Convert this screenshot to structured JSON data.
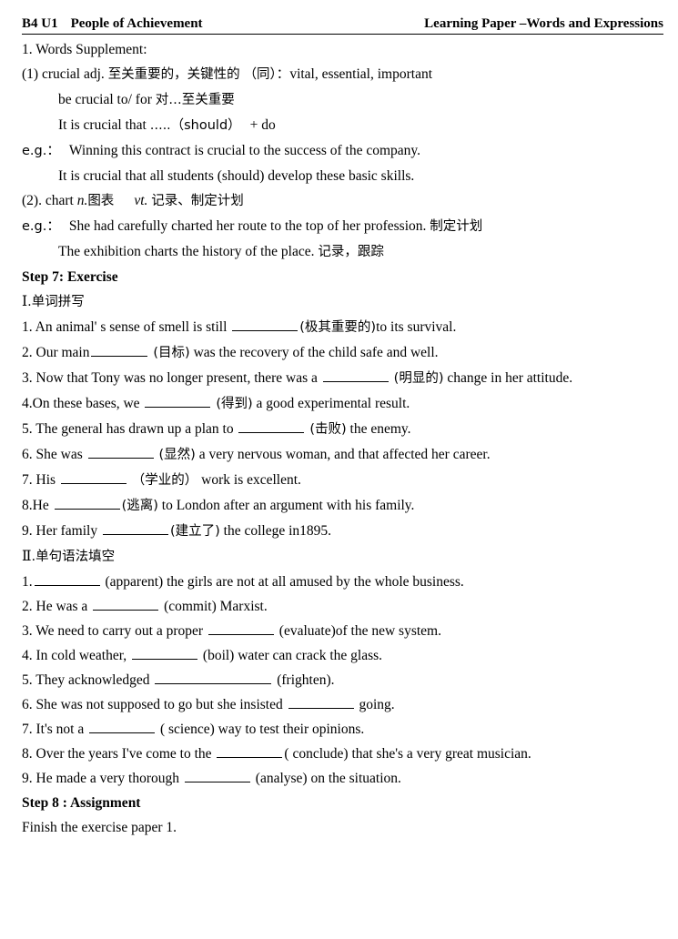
{
  "header": {
    "unit": "B4 U1",
    "title": "People of Achievement",
    "right": "Learning Paper –Words and Expressions"
  },
  "words_supplement": {
    "heading": "1. Words Supplement:",
    "entries": [
      {
        "number": "(1)",
        "word": "crucial",
        "pos": "adj.",
        "meaning_cn": "至关重要的，关键性的",
        "synonym_label": "（同）：",
        "synonyms": "vital, essential, important",
        "usages": [
          {
            "en": "be crucial to/ for",
            "cn": "对…至关重要"
          },
          {
            "en_pre": "It is crucial that",
            "dots": "…..",
            "paren": "（should）",
            "tail": "+ do"
          }
        ],
        "examples_label": "e.g.：",
        "examples": [
          {
            "text": "Winning this contract is crucial to the success of the company.",
            "note": ""
          },
          {
            "text": "It is crucial that all students (should) develop these basic skills.",
            "note": ""
          }
        ]
      },
      {
        "number": "(2).",
        "word": "chart",
        "pos1": "n.",
        "meaning1_cn": "图表",
        "pos2": "vt.",
        "meaning2_cn": "记录、制定计划",
        "examples_label": "e.g.：",
        "examples": [
          {
            "text": "She had carefully charted her route to the top of her profession.",
            "note": "制定计划"
          },
          {
            "text": "The exhibition charts the history of the place.",
            "note": "记录，跟踪"
          }
        ]
      }
    ]
  },
  "step7": {
    "heading": "Step 7: Exercise",
    "part1": {
      "numeral": "I",
      "title": ".单词拼写",
      "items": [
        {
          "num": "1.",
          "pre": "An animal' s sense of smell is still",
          "blank": "b-m",
          "hint": "(极其重要的)",
          "post": "to its survival."
        },
        {
          "num": "2.",
          "pre": "Our main",
          "blank": "b-s",
          "hint": "(目标)",
          "post": "was the recovery of the child safe and well."
        },
        {
          "num": "3.",
          "pre": "Now that Tony was no longer present, there was a",
          "blank": "b-m",
          "hint": "(明显的)",
          "post": "change in her attitude."
        },
        {
          "num": "4.",
          "pre": "On these bases, we",
          "blank": "b-m",
          "hint": "(得到)",
          "post": "a good experimental result."
        },
        {
          "num": "5.",
          "pre": "The general has drawn up a plan to",
          "blank": "b-m",
          "hint": "(击败)",
          "post": "the enemy."
        },
        {
          "num": "6.",
          "pre": "She was",
          "blank": "b-m",
          "hint": "(显然)",
          "post": "a very nervous woman, and that affected her career."
        },
        {
          "num": "7.",
          "pre": "His",
          "blank": "b-m",
          "hint": "（学业的）",
          "post": "work is excellent."
        },
        {
          "num": "8.",
          "pre": "He",
          "blank": "b-m",
          "hint": "(逃离)",
          "post": "to London after an argument with his family."
        },
        {
          "num": "9.",
          "pre": "Her family",
          "blank": "b-m",
          "hint": "(建立了)",
          "post": "the college in1895."
        }
      ]
    },
    "part2": {
      "numeral": "Ⅱ",
      "title": ".单句语法填空",
      "items": [
        {
          "num": "1.",
          "pre": "",
          "blank": "b-m",
          "hint": "(apparent)",
          "post": "the girls are not at all amused by the whole business."
        },
        {
          "num": "2.",
          "pre": "He was a",
          "blank": "b-m",
          "hint": "(commit)",
          "post": "Marxist."
        },
        {
          "num": "3.",
          "pre": "We need to carry out a proper",
          "blank": "b-m",
          "hint": "(evaluate)",
          "post": "of the new system."
        },
        {
          "num": "4.",
          "pre": "In cold weather,",
          "blank": "b-m",
          "hint": "(boil)",
          "post": "water can crack the glass."
        },
        {
          "num": "5.",
          "pre": "They acknowledged",
          "blank": "b-l",
          "hint": "(frighten).",
          "post": ""
        },
        {
          "num": "6.",
          "pre": "She was not supposed to go but she insisted",
          "blank": "b-m",
          "hint": "",
          "post": "going."
        },
        {
          "num": "7.",
          "pre": "It's not a",
          "blank": "b-m",
          "hint": "( science)",
          "post": "way to test their opinions."
        },
        {
          "num": "8.",
          "pre": "Over the years I've come to the",
          "blank": "b-m",
          "hint": "( conclude)",
          "post": "that she's a very great musician."
        },
        {
          "num": "9.",
          "pre": "He made a very thorough",
          "blank": "b-m",
          "hint": "(analyse)",
          "post": "on the situation."
        }
      ]
    }
  },
  "step8": {
    "heading": "Step 8 : Assignment",
    "body": "Finish the exercise paper 1."
  }
}
